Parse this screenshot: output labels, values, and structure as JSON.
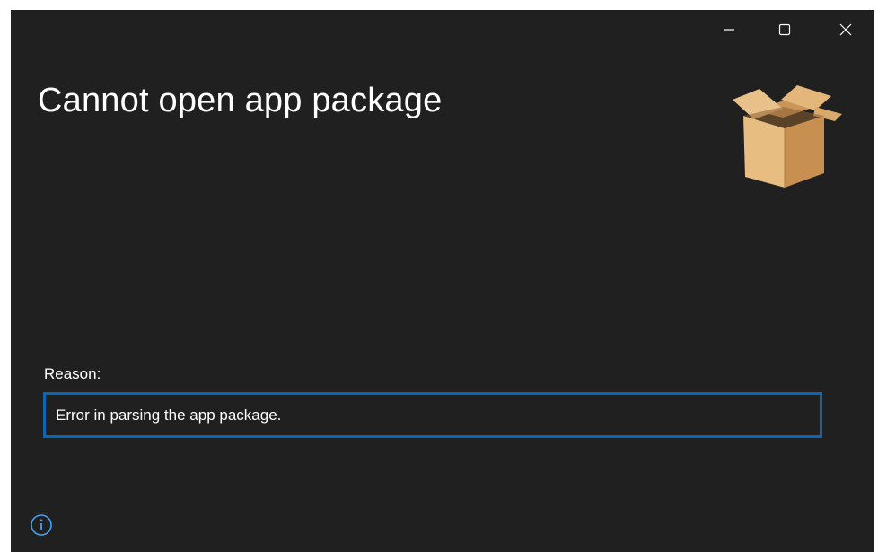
{
  "window": {
    "title": "Cannot open app package",
    "background_color": "#202020"
  },
  "caption_buttons": {
    "minimize_icon": "minimize-icon",
    "maximize_icon": "maximize-icon",
    "close_icon": "close-icon"
  },
  "app_icon": "package-box-icon",
  "reason": {
    "label": "Reason:",
    "value": "Error in parsing the app package.",
    "border_color": "#0a67b8"
  },
  "footer": {
    "info_icon": "info-icon",
    "accent_color": "#4aa0f0"
  }
}
